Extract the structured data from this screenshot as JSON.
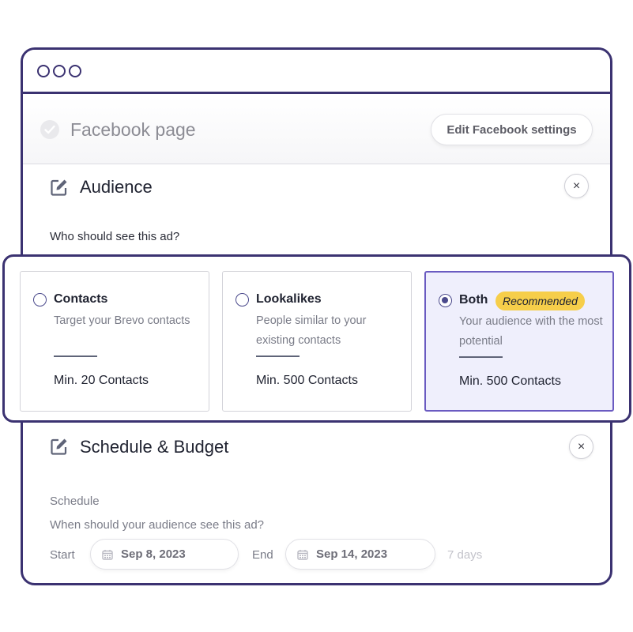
{
  "window_controls": [
    "circle-1",
    "circle-2",
    "circle-3"
  ],
  "facebook": {
    "title": "Facebook page",
    "button_label": "Edit Facebook settings"
  },
  "audience": {
    "title": "Audience",
    "close_icon": "×",
    "question": "Who should see this ad?",
    "options": [
      {
        "title": "Contacts",
        "description": "Target your Brevo contacts",
        "min": "Min. 20 Contacts",
        "selected": false
      },
      {
        "title": "Lookalikes",
        "description": "People similar to your existing contacts",
        "min": "Min. 500 Contacts",
        "selected": false
      },
      {
        "title": "Both",
        "badge": "Recommended",
        "description": "Your audience with the most potential",
        "min": "Min. 500 Contacts",
        "selected": true
      }
    ]
  },
  "schedule": {
    "title": "Schedule & Budget",
    "close_icon": "×",
    "label": "Schedule",
    "question": "When should your audience see this ad?",
    "start_label": "Start",
    "start_value": "Sep 8, 2023",
    "end_label": "End",
    "end_value": "Sep 14, 2023",
    "duration": "7 days"
  },
  "colors": {
    "frame": "#3b3271",
    "selected_bg": "#efeffc",
    "selected_border": "#6a5bc1",
    "badge": "#f6ce4a"
  }
}
